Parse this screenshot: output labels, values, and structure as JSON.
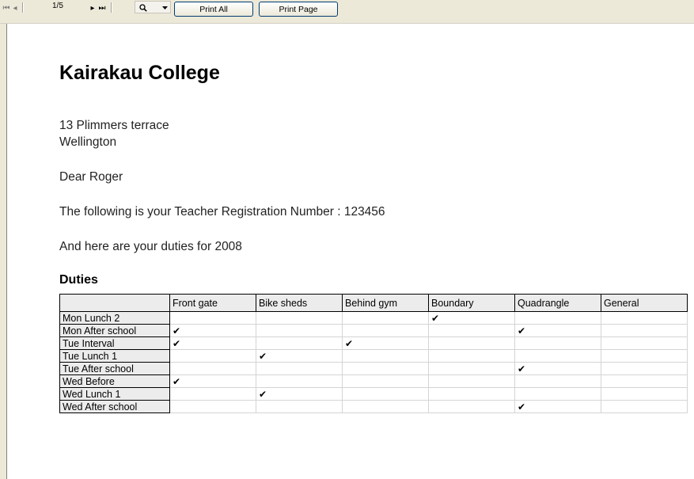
{
  "toolbar": {
    "first_page_icon": "first-page-icon",
    "prev_page_icon": "prev-page-icon",
    "page_indicator": "1/5",
    "next_page_icon": "next-page-icon",
    "last_page_icon": "last-page-icon",
    "search_icon": "search-icon",
    "dropdown_icon": "chevron-down-icon",
    "print_all_label": "Print All",
    "print_page_label": "Print Page"
  },
  "letter": {
    "school_name": "Kairakau College",
    "address_line1": "13 Plimmers terrace",
    "address_line2": "Wellington",
    "greeting": "Dear Roger",
    "registration_line": "The following is your Teacher Registration Number :  123456",
    "duties_intro": "And here are your duties for 2008",
    "duties_heading": "Duties"
  },
  "duties_table": {
    "columns": [
      "Front gate",
      "Bike sheds",
      "Behind gym",
      "Boundary",
      "Quadrangle",
      "General"
    ],
    "rows": [
      {
        "label": "Mon Lunch 2",
        "ticks": [
          false,
          false,
          false,
          true,
          false,
          false
        ]
      },
      {
        "label": "Mon After school",
        "ticks": [
          true,
          false,
          false,
          false,
          true,
          false
        ]
      },
      {
        "label": "Tue Interval",
        "ticks": [
          true,
          false,
          true,
          false,
          false,
          false
        ]
      },
      {
        "label": "Tue Lunch 1",
        "ticks": [
          false,
          true,
          false,
          false,
          false,
          false
        ]
      },
      {
        "label": "Tue After school",
        "ticks": [
          false,
          false,
          false,
          false,
          true,
          false
        ]
      },
      {
        "label": "Wed Before",
        "ticks": [
          true,
          false,
          false,
          false,
          false,
          false
        ]
      },
      {
        "label": "Wed Lunch 1",
        "ticks": [
          false,
          true,
          false,
          false,
          false,
          false
        ]
      },
      {
        "label": "Wed After school",
        "ticks": [
          false,
          false,
          false,
          false,
          true,
          false
        ]
      }
    ],
    "tick_glyph": "✔"
  }
}
